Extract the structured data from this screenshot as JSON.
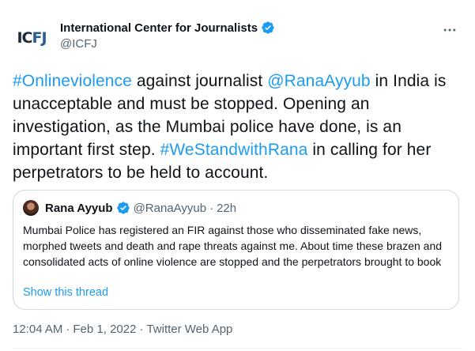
{
  "account": {
    "logo_left": "IC",
    "logo_right": "FJ",
    "display_name": "International Center for Journalists",
    "handle": "@ICFJ"
  },
  "tweet": {
    "part1": "#Onlineviolence",
    "part2": " against journalist ",
    "part3": "@RanaAyyub",
    "part4": " in India is unacceptable and must be stopped. Opening an investigation, as the Mumbai police have done, is an important first step. ",
    "part5": "#WeStandwithRana",
    "part6": " in calling for her perpetrators to be held to account."
  },
  "quote": {
    "display_name": "Rana Ayyub",
    "handle": "@RanaAyyub",
    "separator": "·",
    "time": "22h",
    "text": "Mumbai Police has registered an FIR against those who disseminated fake news, morphed tweets and death and rape threats against me. About time these brazen and consolidated acts of online violence are stopped and the perpetrators brought to book",
    "show_thread": "Show this thread"
  },
  "meta": {
    "time": "12:04 AM",
    "sep1": "·",
    "date": "Feb 1, 2022",
    "sep2": "·",
    "app": "Twitter Web App"
  },
  "colors": {
    "link": "#1d9bf0",
    "secondary_text": "#536471",
    "verified": "#1d9bf0",
    "border": "#cfd9de"
  },
  "icons": {
    "more": "more-horizontal-icon",
    "verified": "verified-badge-icon"
  }
}
